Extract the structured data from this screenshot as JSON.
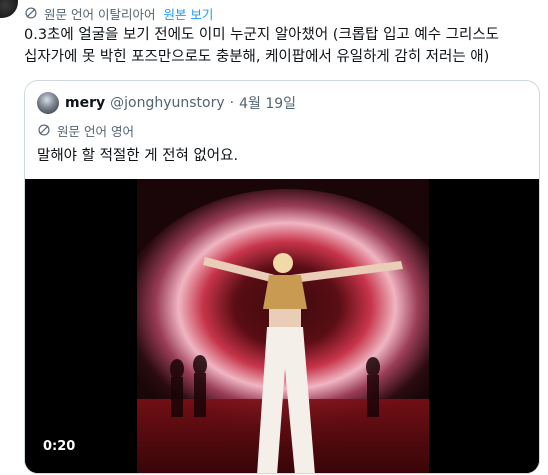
{
  "translation_bar": {
    "label": "원문 언어 이탈리아어",
    "show_original": "원본 보기"
  },
  "tweet": {
    "text": "0.3초에 얼굴을 보기 전에도 이미 누군지 알아챘어 (크롭탑 입고 예수 그리스도\n십자가에 못 박힌 포즈만으로도 충분해, 케이팝에서 유일하게 감히 저러는 애)"
  },
  "quote": {
    "name": "mery",
    "handle": "@jonghyunstory",
    "separator": "·",
    "date": "4월 19일",
    "translation_label": "원문 언어 영어",
    "text": "말해야 할 적절한 게 전혀 없어요.",
    "video": {
      "duration": "0:20"
    }
  },
  "colors": {
    "link": "#1d9bf0",
    "secondary_text": "#536471",
    "border": "#cfd9de"
  },
  "icons": {
    "translation": "globe-icon"
  }
}
